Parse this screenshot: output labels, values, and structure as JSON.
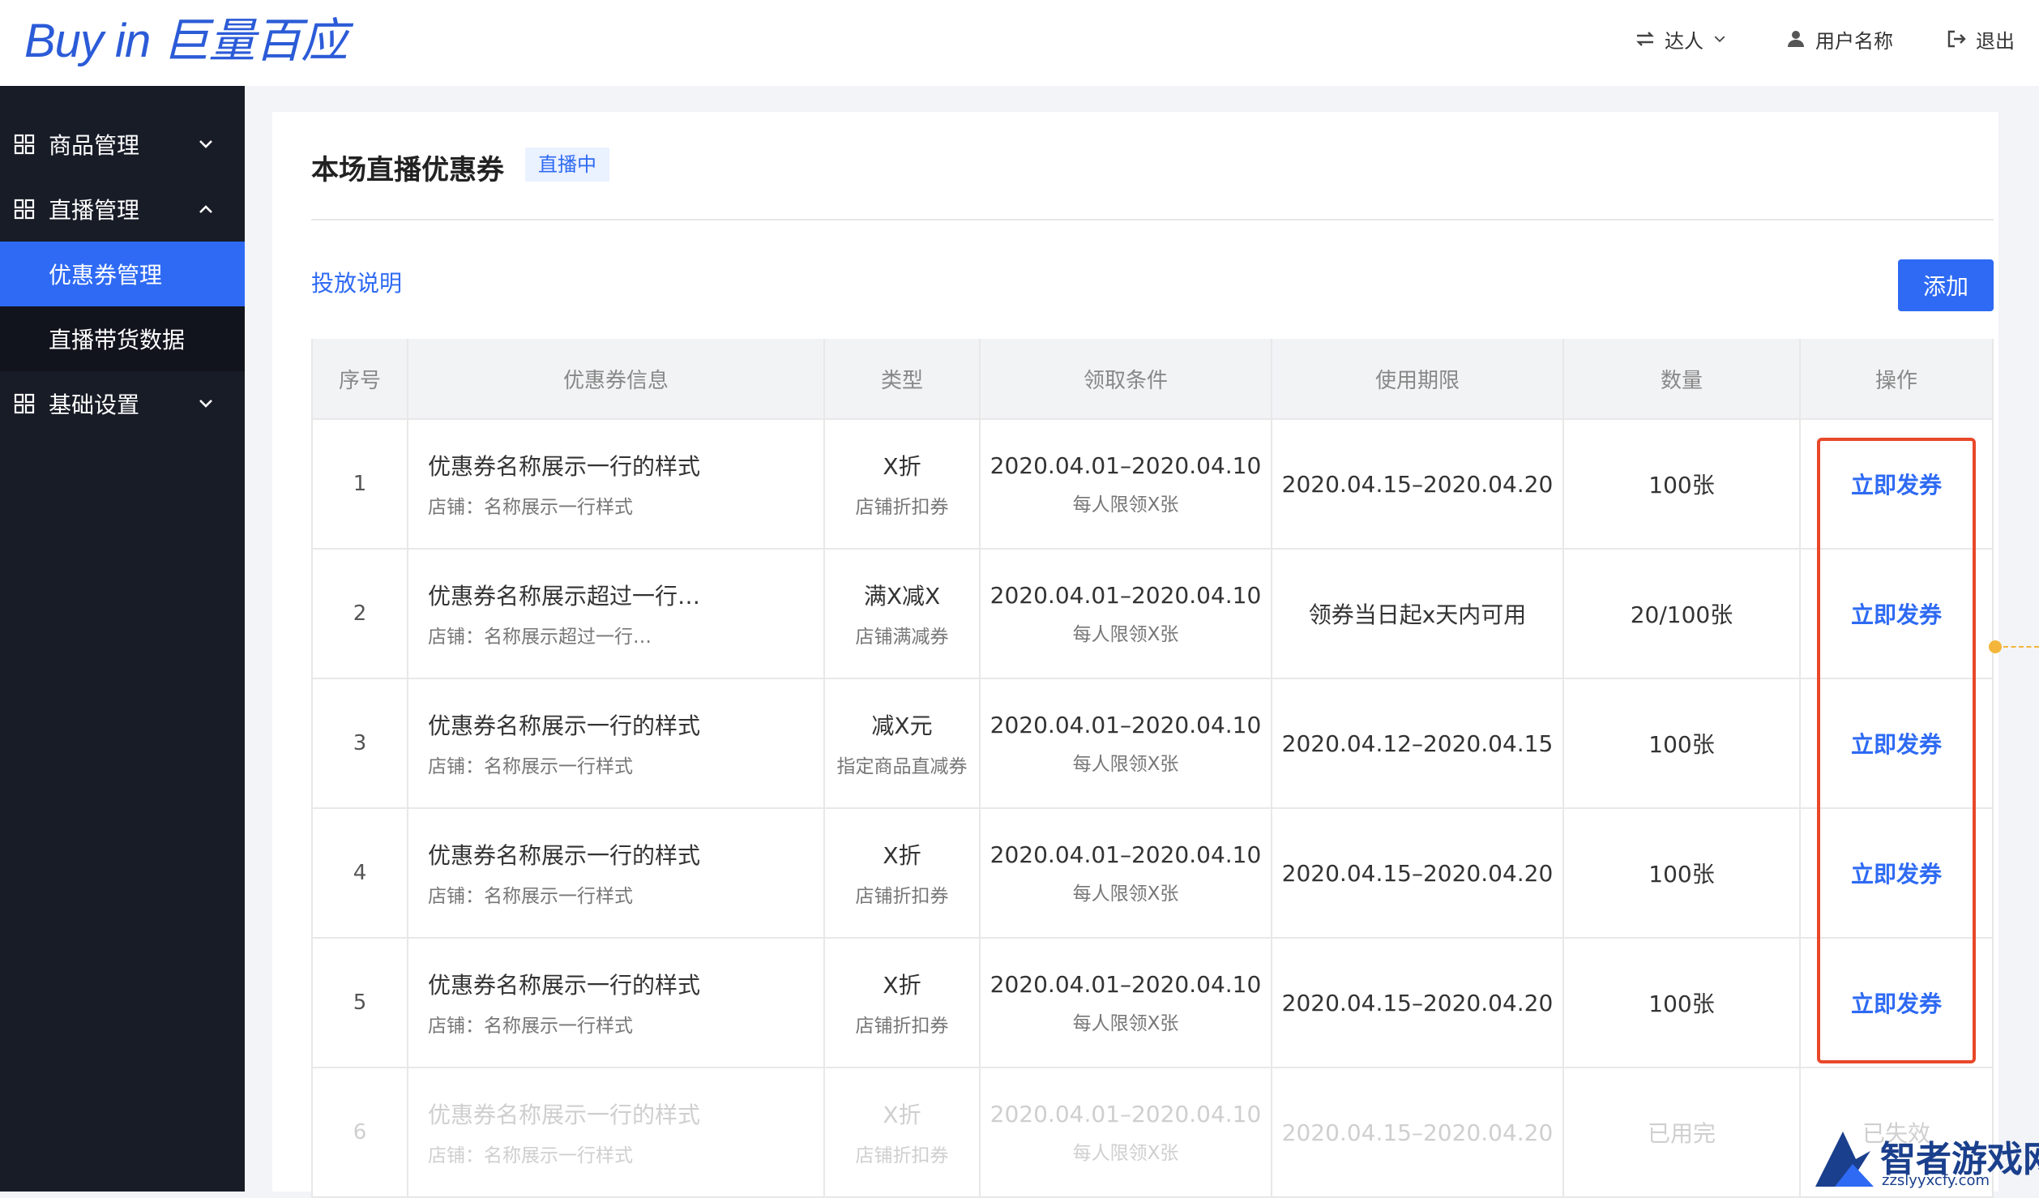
{
  "header": {
    "logo_text": "Buy in 巨量百应",
    "role_switch": "达人",
    "username": "用户名称",
    "logout": "退出"
  },
  "sidebar": {
    "items": [
      {
        "label": "商品管理",
        "icon": "grid-icon",
        "expanded": false
      },
      {
        "label": "直播管理",
        "icon": "grid-icon",
        "expanded": true
      },
      {
        "label": "基础设置",
        "icon": "grid-icon",
        "expanded": false
      }
    ],
    "subitems": [
      {
        "label": "优惠券管理",
        "active": true
      },
      {
        "label": "直播带货数据",
        "active": false
      }
    ]
  },
  "main": {
    "title": "本场直播优惠券",
    "status_tag": "直播中",
    "intro_link": "投放说明",
    "add_button": "添加"
  },
  "table": {
    "columns": [
      "序号",
      "优惠券信息",
      "类型",
      "领取条件",
      "使用期限",
      "数量",
      "操作"
    ],
    "rows": [
      {
        "no": "1",
        "name": "优惠券名称展示一行的样式",
        "shop": "店铺：名称展示一行样式",
        "type": "X折",
        "type_sub": "店铺折扣券",
        "cond": "2020.04.01–2020.04.10",
        "cond_sub": "每人限领X张",
        "period": "2020.04.15–2020.04.20",
        "qty": "100张",
        "action": "立即发券"
      },
      {
        "no": "2",
        "name": "优惠券名称展示超过一行…",
        "shop": "店铺：名称展示超过一行…",
        "type": "满X减X",
        "type_sub": "店铺满减券",
        "cond": "2020.04.01–2020.04.10",
        "cond_sub": "每人限领X张",
        "period": "领券当日起x天内可用",
        "qty": "20/100张",
        "action": "立即发券"
      },
      {
        "no": "3",
        "name": "优惠券名称展示一行的样式",
        "shop": "店铺：名称展示一行样式",
        "type": "减X元",
        "type_sub": "指定商品直减券",
        "cond": "2020.04.01–2020.04.10",
        "cond_sub": "每人限领X张",
        "period": "2020.04.12–2020.04.15",
        "qty": "100张",
        "action": "立即发券"
      },
      {
        "no": "4",
        "name": "优惠券名称展示一行的样式",
        "shop": "店铺：名称展示一行样式",
        "type": "X折",
        "type_sub": "店铺折扣券",
        "cond": "2020.04.01–2020.04.10",
        "cond_sub": "每人限领X张",
        "period": "2020.04.15–2020.04.20",
        "qty": "100张",
        "action": "立即发券"
      },
      {
        "no": "5",
        "name": "优惠券名称展示一行的样式",
        "shop": "店铺：名称展示一行样式",
        "type": "X折",
        "type_sub": "店铺折扣券",
        "cond": "2020.04.01–2020.04.10",
        "cond_sub": "每人限领X张",
        "period": "2020.04.15–2020.04.20",
        "qty": "100张",
        "action": "立即发券"
      },
      {
        "no": "6",
        "name": "优惠券名称展示一行的样式",
        "shop": "店铺：名称展示一行样式",
        "type": "X折",
        "type_sub": "店铺折扣券",
        "cond": "2020.04.01–2020.04.10",
        "cond_sub": "每人限领X张",
        "period": "2020.04.15–2020.04.20",
        "qty": "已用完",
        "action": "已失效",
        "disabled": true
      }
    ]
  },
  "watermark": {
    "text": "智者游戏网",
    "url": "zzslyyxcfy.com"
  },
  "colors": {
    "brand": "#2e6af3",
    "sidebar_bg": "#181c27",
    "highlight": "#e8482a",
    "marker": "#f3b63a"
  }
}
